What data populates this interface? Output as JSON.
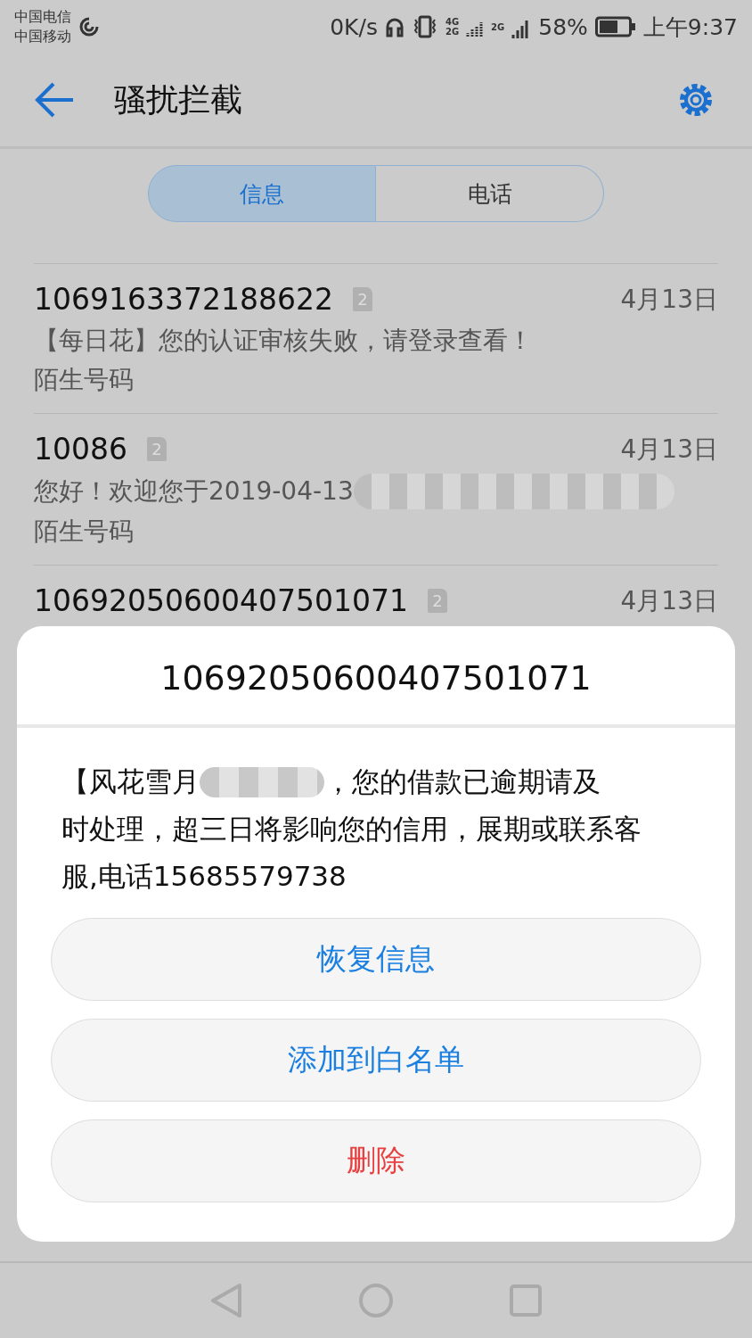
{
  "status_bar": {
    "carriers": [
      "中国电信",
      "中国移动"
    ],
    "speed": "0K/s",
    "network_a": "4G",
    "network_b": "2G",
    "network_c": "2G",
    "battery": "58%",
    "time": "上午9:37"
  },
  "header": {
    "title": "骚扰拦截"
  },
  "tabs": [
    {
      "label": "信息",
      "selected": true
    },
    {
      "label": "电话",
      "selected": false
    }
  ],
  "messages": [
    {
      "sender": "1069163372188622",
      "sim": "2",
      "preview": "【每日花】您的认证审核失败，请登录查看！",
      "tag": "陌生号码",
      "date": "4月13日"
    },
    {
      "sender": "10086",
      "sim": "2",
      "preview": "您好！欢迎您于2019-04-13",
      "blurred": true,
      "tag": "陌生号码",
      "date": "4月13日"
    },
    {
      "sender": "10692050600407501071",
      "sim": "2",
      "date": "4月13日"
    }
  ],
  "dialog": {
    "title": "10692050600407501071",
    "message_before": "【风花雪月",
    "message_line_end": "，您的借款已逾期请及",
    "message_after": "时处理，超三日将影响您的信用，展期或联系客服,电话15685579738",
    "buttons": [
      {
        "label": "恢复信息",
        "kind": "normal"
      },
      {
        "label": "添加到白名单",
        "kind": "normal"
      },
      {
        "label": "删除",
        "kind": "danger"
      }
    ]
  }
}
